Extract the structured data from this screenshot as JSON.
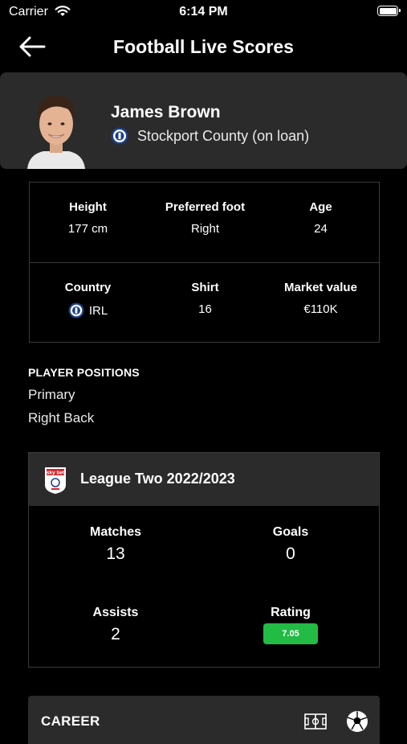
{
  "status_bar": {
    "carrier": "Carrier",
    "time": "6:14 PM"
  },
  "nav": {
    "title": "Football Live Scores"
  },
  "player": {
    "name": "James Brown",
    "club": "Stockport County (on loan)"
  },
  "info": {
    "height_label": "Height",
    "height_value": "177 cm",
    "foot_label": "Preferred foot",
    "foot_value": "Right",
    "age_label": "Age",
    "age_value": "24",
    "country_label": "Country",
    "country_value": "IRL",
    "shirt_label": "Shirt",
    "shirt_value": "16",
    "market_label": "Market value",
    "market_value": "€110K"
  },
  "positions": {
    "heading": "PLAYER POSITIONS",
    "primary_label": "Primary",
    "primary_value": "Right Back"
  },
  "league": {
    "logo_text": "sky bet",
    "name": "League Two 2022/2023",
    "matches_label": "Matches",
    "matches_value": "13",
    "goals_label": "Goals",
    "goals_value": "0",
    "assists_label": "Assists",
    "assists_value": "2",
    "rating_label": "Rating",
    "rating_value": "7.05",
    "rating_color": "#22bb44"
  },
  "career": {
    "title": "CAREER"
  },
  "icons": [
    "wifi-icon",
    "battery-icon",
    "back-arrow-icon",
    "club-badge-icon",
    "league-logo-icon",
    "pitch-icon",
    "football-icon"
  ]
}
